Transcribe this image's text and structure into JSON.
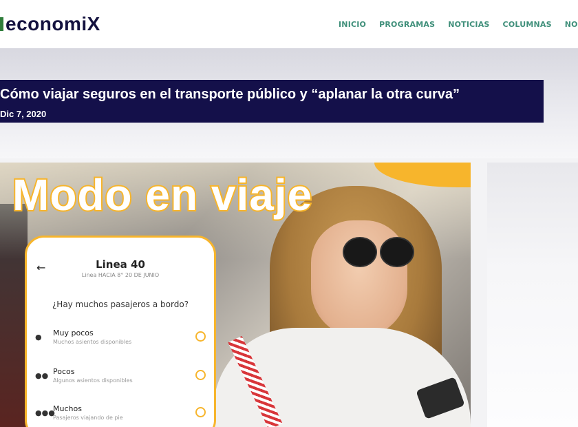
{
  "brand": {
    "logo_text": "economiX"
  },
  "nav": {
    "items": [
      "INICIO",
      "PROGRAMAS",
      "NOTICIAS",
      "COLUMNAS",
      "NO"
    ]
  },
  "article": {
    "title": "Cómo viajar seguros en el transporte público y “aplanar la otra curva”",
    "date": "Dic 7, 2020"
  },
  "image": {
    "banner_text": "Modo en viaje",
    "app": {
      "line_title": "Linea 40",
      "line_subtitle": "Linea HACIA 8° 20 DE JUNIO",
      "question": "¿Hay muchos pasajeros a bordo?",
      "options": [
        {
          "label": "Muy pocos",
          "desc": "Muchos asientos disponibles",
          "icon": "person-icon"
        },
        {
          "label": "Pocos",
          "desc": "Algunos asientos disponibles",
          "icon": "two-people-icon"
        },
        {
          "label": "Muchos",
          "desc": "Pasajeros viajando de pie",
          "icon": "crowd-icon"
        }
      ]
    }
  },
  "colors": {
    "brand_navy": "#14104a",
    "accent_yellow": "#f7b52c",
    "nav_teal": "#3f8f7a"
  }
}
